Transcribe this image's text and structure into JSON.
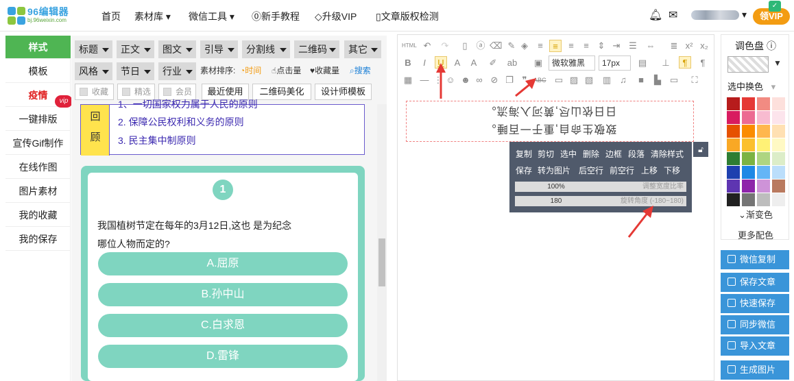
{
  "brand": {
    "name": "96编辑器",
    "url": "bj.96weixin.com"
  },
  "nav": {
    "home": "首页",
    "materials": "素材库",
    "wechat_tools": "微信工具",
    "tutorial": "新手教程",
    "upgrade": "升级VIP",
    "copyright": "文章版权检测",
    "vip_button": "领VIP"
  },
  "sidebar": {
    "items": [
      "样式",
      "模板",
      "疫情",
      "一键排版",
      "宣传Gif制作",
      "在线作图",
      "图片素材",
      "我的收藏",
      "我的保存"
    ],
    "vip_badge": "vip"
  },
  "filters": {
    "row1": [
      "标题",
      "正文",
      "图文",
      "引导",
      "分割线",
      "二维码",
      "其它"
    ],
    "row2": [
      "风格",
      "节日",
      "行业"
    ],
    "sort_label": "素材排序:",
    "sort_time": "时间",
    "sort_clicks": "点击量",
    "sort_favorites": "收藏量",
    "search": "搜索",
    "checks": [
      "收藏",
      "精选",
      "会员"
    ],
    "buttons": [
      "最近使用",
      "二维码美化",
      "设计师模板"
    ]
  },
  "preview": {
    "review_label": "回顾",
    "review_lines": [
      "1、一切国家权力属于人民的原则",
      "2. 保障公民权利和义务的原则",
      "3. 民主集中制原则"
    ],
    "quiz_number": "1",
    "question_line1": "我国植树节定在每年的3月12日,这也 是为纪念",
    "question_line2": "哪位人物而定的?",
    "options": [
      "A.屈原",
      "B.孙中山",
      "C.白求恩",
      "D.雷锋"
    ]
  },
  "editor": {
    "font_family": "微软雅黑",
    "font_size": "17px",
    "flipped_line1": "致敬生命自,重于一百睡。",
    "flipped_line2": "日日依山尽,黄河入海流。"
  },
  "popup": {
    "row1": [
      "复制",
      "剪切",
      "选中",
      "删除",
      "边框",
      "段落",
      "清除样式"
    ],
    "row2": [
      "保存",
      "转为图片",
      "后空行",
      "前空行",
      "上移",
      "下移"
    ],
    "width_value": "100%",
    "width_label": "调整宽度比率",
    "rotate_value": "180",
    "rotate_label": "旋转角度 (-180~180)"
  },
  "color_panel": {
    "title": "调色盘",
    "subtitle": "选中换色",
    "gradient": "渐变色",
    "more": "更多配色",
    "swatches": [
      "#b71c1c",
      "#e53935",
      "#f28b82",
      "#fde0dc",
      "#d81b60",
      "#ec6a92",
      "#f8bbd0",
      "#fce4ec",
      "#e65100",
      "#fb8c00",
      "#ffb74d",
      "#ffe0b2",
      "#f9a825",
      "#fbc02d",
      "#fff176",
      "#fff9c4",
      "#2e7d32",
      "#7cb342",
      "#aed581",
      "#dcedc8",
      "#1e40af",
      "#1e88e5",
      "#64b5f6",
      "#bbdefb",
      "#5e35b1",
      "#8e24aa",
      "#ce93d8",
      "#b97a5f",
      "#212121",
      "#757575",
      "#bdbdbd",
      "#eeeeee"
    ]
  },
  "actions": [
    "微信复制",
    "保存文章",
    "快速保存",
    "同步微信",
    "导入文章",
    "生成图片"
  ]
}
